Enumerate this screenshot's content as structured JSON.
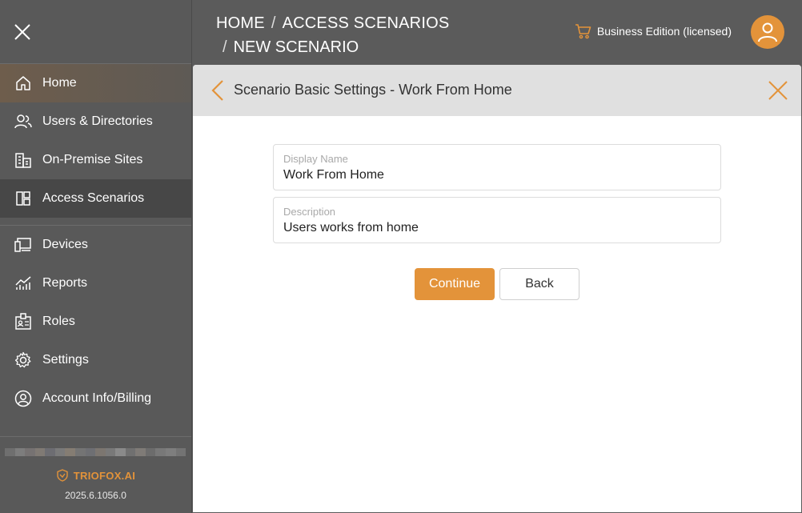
{
  "sidebar": {
    "items": [
      {
        "label": "Home",
        "icon": "home-icon"
      },
      {
        "label": "Users & Directories",
        "icon": "users-icon"
      },
      {
        "label": "On-Premise Sites",
        "icon": "building-icon"
      },
      {
        "label": "Access Scenarios",
        "icon": "layout-icon"
      },
      {
        "label": "Devices",
        "icon": "devices-icon"
      },
      {
        "label": "Reports",
        "icon": "chart-icon"
      },
      {
        "label": "Roles",
        "icon": "id-card-icon"
      },
      {
        "label": "Settings",
        "icon": "gear-icon"
      },
      {
        "label": "Account Info/Billing",
        "icon": "account-icon"
      }
    ],
    "brand": "TRIOFOX.AI",
    "version": "2025.6.1056.0"
  },
  "header": {
    "breadcrumb": [
      "HOME",
      "ACCESS SCENARIOS",
      "NEW SCENARIO"
    ],
    "separator": "/",
    "edition": "Business Edition (licensed)"
  },
  "panel": {
    "title": "Scenario Basic Settings - Work From Home",
    "fields": [
      {
        "label": "Display Name",
        "value": "Work From Home"
      },
      {
        "label": "Description",
        "value": "Users works from home"
      }
    ],
    "continue_label": "Continue",
    "back_label": "Back"
  },
  "colors": {
    "accent": "#e3933a",
    "sidebar_bg": "#595959",
    "panel_head_bg": "#e0e0e0"
  }
}
